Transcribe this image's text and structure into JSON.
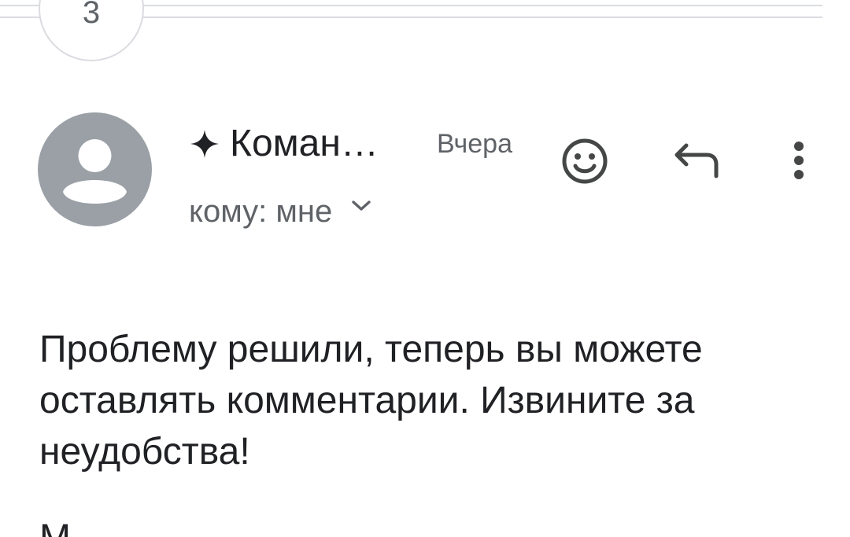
{
  "thread": {
    "collapsed_count": "3"
  },
  "message": {
    "sender_name": "Коман…",
    "timestamp": "Вчера",
    "recipient": "кому: мне",
    "body": "Проблему решили, теперь вы можете оставлять комментарии. Извините за неудобства!",
    "body_next_partial": "М"
  },
  "icons": {
    "sender_badge": "sparkle-icon",
    "avatar": "person-icon",
    "expand_recipients": "chevron-down-icon",
    "react": "emoji-icon",
    "reply": "reply-icon",
    "more": "more-vert-icon"
  },
  "colors": {
    "avatar_bg": "#9aa0a6",
    "icon": "#444746",
    "secondary_text": "#5f6368",
    "divider": "#dadce0"
  }
}
